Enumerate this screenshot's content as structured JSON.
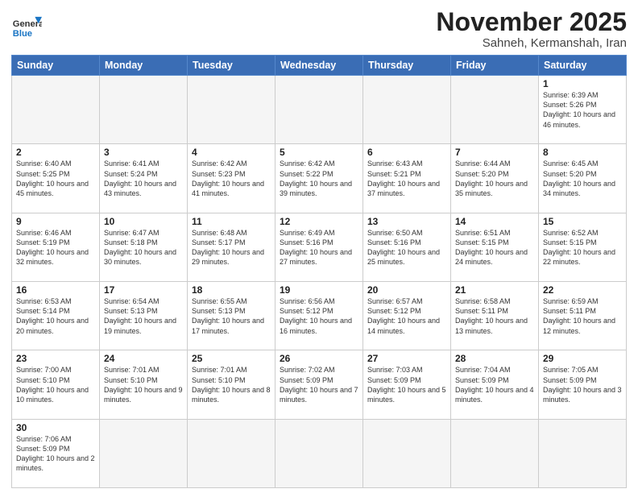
{
  "logo": {
    "line1": "General",
    "line2": "Blue"
  },
  "title": "November 2025",
  "subtitle": "Sahneh, Kermanshah, Iran",
  "weekdays": [
    "Sunday",
    "Monday",
    "Tuesday",
    "Wednesday",
    "Thursday",
    "Friday",
    "Saturday"
  ],
  "weeks": [
    [
      {
        "day": "",
        "info": ""
      },
      {
        "day": "",
        "info": ""
      },
      {
        "day": "",
        "info": ""
      },
      {
        "day": "",
        "info": ""
      },
      {
        "day": "",
        "info": ""
      },
      {
        "day": "",
        "info": ""
      },
      {
        "day": "1",
        "info": "Sunrise: 6:39 AM\nSunset: 5:26 PM\nDaylight: 10 hours and 46 minutes."
      }
    ],
    [
      {
        "day": "2",
        "info": "Sunrise: 6:40 AM\nSunset: 5:25 PM\nDaylight: 10 hours and 45 minutes."
      },
      {
        "day": "3",
        "info": "Sunrise: 6:41 AM\nSunset: 5:24 PM\nDaylight: 10 hours and 43 minutes."
      },
      {
        "day": "4",
        "info": "Sunrise: 6:42 AM\nSunset: 5:23 PM\nDaylight: 10 hours and 41 minutes."
      },
      {
        "day": "5",
        "info": "Sunrise: 6:42 AM\nSunset: 5:22 PM\nDaylight: 10 hours and 39 minutes."
      },
      {
        "day": "6",
        "info": "Sunrise: 6:43 AM\nSunset: 5:21 PM\nDaylight: 10 hours and 37 minutes."
      },
      {
        "day": "7",
        "info": "Sunrise: 6:44 AM\nSunset: 5:20 PM\nDaylight: 10 hours and 35 minutes."
      },
      {
        "day": "8",
        "info": "Sunrise: 6:45 AM\nSunset: 5:20 PM\nDaylight: 10 hours and 34 minutes."
      }
    ],
    [
      {
        "day": "9",
        "info": "Sunrise: 6:46 AM\nSunset: 5:19 PM\nDaylight: 10 hours and 32 minutes."
      },
      {
        "day": "10",
        "info": "Sunrise: 6:47 AM\nSunset: 5:18 PM\nDaylight: 10 hours and 30 minutes."
      },
      {
        "day": "11",
        "info": "Sunrise: 6:48 AM\nSunset: 5:17 PM\nDaylight: 10 hours and 29 minutes."
      },
      {
        "day": "12",
        "info": "Sunrise: 6:49 AM\nSunset: 5:16 PM\nDaylight: 10 hours and 27 minutes."
      },
      {
        "day": "13",
        "info": "Sunrise: 6:50 AM\nSunset: 5:16 PM\nDaylight: 10 hours and 25 minutes."
      },
      {
        "day": "14",
        "info": "Sunrise: 6:51 AM\nSunset: 5:15 PM\nDaylight: 10 hours and 24 minutes."
      },
      {
        "day": "15",
        "info": "Sunrise: 6:52 AM\nSunset: 5:15 PM\nDaylight: 10 hours and 22 minutes."
      }
    ],
    [
      {
        "day": "16",
        "info": "Sunrise: 6:53 AM\nSunset: 5:14 PM\nDaylight: 10 hours and 20 minutes."
      },
      {
        "day": "17",
        "info": "Sunrise: 6:54 AM\nSunset: 5:13 PM\nDaylight: 10 hours and 19 minutes."
      },
      {
        "day": "18",
        "info": "Sunrise: 6:55 AM\nSunset: 5:13 PM\nDaylight: 10 hours and 17 minutes."
      },
      {
        "day": "19",
        "info": "Sunrise: 6:56 AM\nSunset: 5:12 PM\nDaylight: 10 hours and 16 minutes."
      },
      {
        "day": "20",
        "info": "Sunrise: 6:57 AM\nSunset: 5:12 PM\nDaylight: 10 hours and 14 minutes."
      },
      {
        "day": "21",
        "info": "Sunrise: 6:58 AM\nSunset: 5:11 PM\nDaylight: 10 hours and 13 minutes."
      },
      {
        "day": "22",
        "info": "Sunrise: 6:59 AM\nSunset: 5:11 PM\nDaylight: 10 hours and 12 minutes."
      }
    ],
    [
      {
        "day": "23",
        "info": "Sunrise: 7:00 AM\nSunset: 5:10 PM\nDaylight: 10 hours and 10 minutes."
      },
      {
        "day": "24",
        "info": "Sunrise: 7:01 AM\nSunset: 5:10 PM\nDaylight: 10 hours and 9 minutes."
      },
      {
        "day": "25",
        "info": "Sunrise: 7:01 AM\nSunset: 5:10 PM\nDaylight: 10 hours and 8 minutes."
      },
      {
        "day": "26",
        "info": "Sunrise: 7:02 AM\nSunset: 5:09 PM\nDaylight: 10 hours and 7 minutes."
      },
      {
        "day": "27",
        "info": "Sunrise: 7:03 AM\nSunset: 5:09 PM\nDaylight: 10 hours and 5 minutes."
      },
      {
        "day": "28",
        "info": "Sunrise: 7:04 AM\nSunset: 5:09 PM\nDaylight: 10 hours and 4 minutes."
      },
      {
        "day": "29",
        "info": "Sunrise: 7:05 AM\nSunset: 5:09 PM\nDaylight: 10 hours and 3 minutes."
      }
    ],
    [
      {
        "day": "30",
        "info": "Sunrise: 7:06 AM\nSunset: 5:09 PM\nDaylight: 10 hours and 2 minutes."
      },
      {
        "day": "",
        "info": ""
      },
      {
        "day": "",
        "info": ""
      },
      {
        "day": "",
        "info": ""
      },
      {
        "day": "",
        "info": ""
      },
      {
        "day": "",
        "info": ""
      },
      {
        "day": "",
        "info": ""
      }
    ]
  ]
}
